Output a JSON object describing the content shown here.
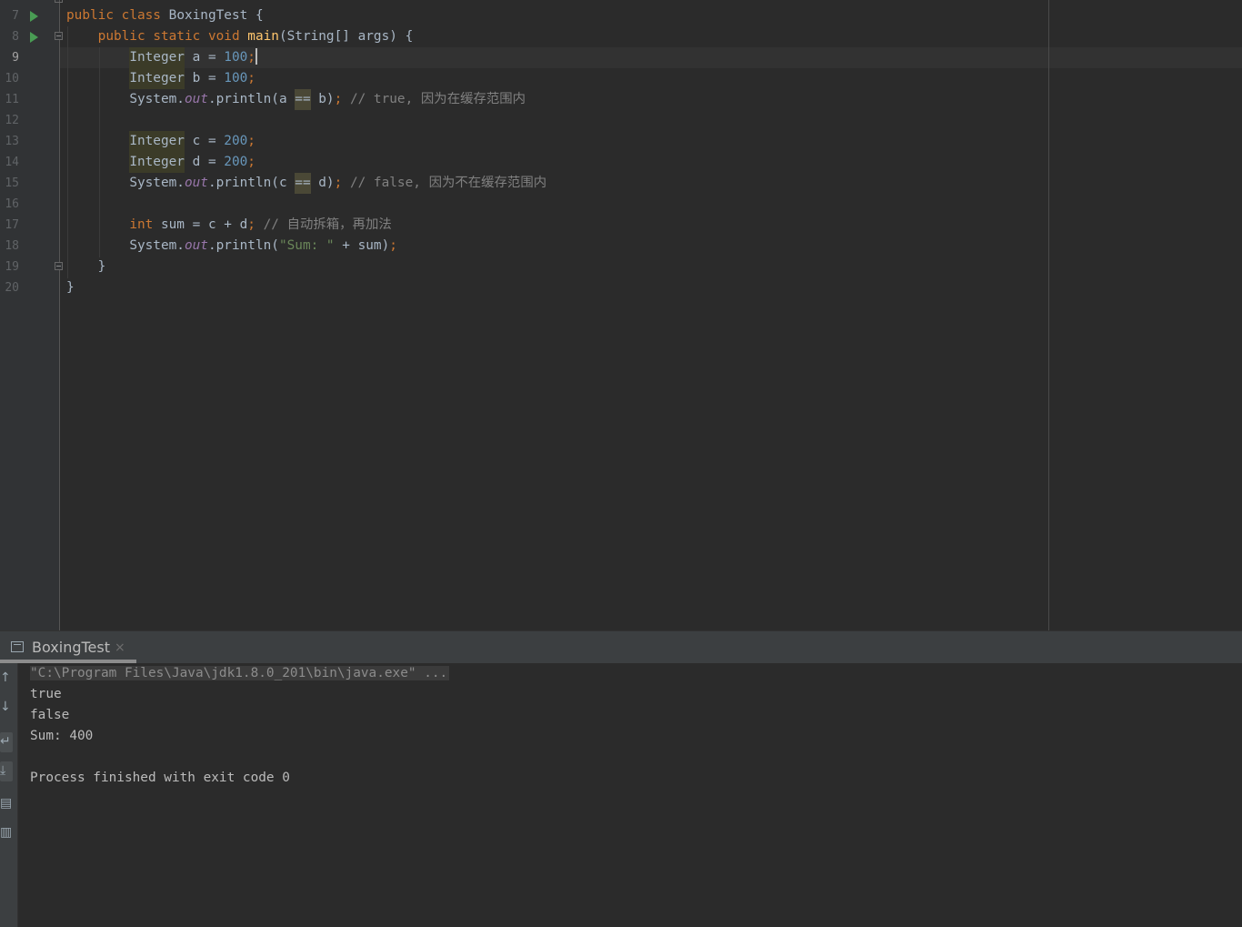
{
  "editor": {
    "line_numbers": [
      "7",
      "8",
      "9",
      "10",
      "11",
      "12",
      "13",
      "14",
      "15",
      "16",
      "17",
      "18",
      "19",
      "20"
    ],
    "current_line": "9",
    "lines": {
      "l7": {
        "kw1": "public",
        "kw2": "class",
        "name": "BoxingTest",
        "brace": "{"
      },
      "l8": {
        "kw1": "public",
        "kw2": "static",
        "kw3": "void",
        "fn": "main",
        "rest": "(String[] args) {"
      },
      "l9": {
        "type": "Integer",
        "decl": " a = ",
        "num": "100",
        "semi": ";"
      },
      "l10": {
        "type": "Integer",
        "decl": " b = ",
        "num": "100",
        "semi": ";"
      },
      "l11": {
        "sys": "System.",
        "out": "out",
        "call": ".println(a ",
        "op": "==",
        "rest": " b)",
        "semi": ";",
        "comment": " // true, 因为在缓存范围内"
      },
      "l13": {
        "type": "Integer",
        "decl": " c = ",
        "num": "200",
        "semi": ";"
      },
      "l14": {
        "type": "Integer",
        "decl": " d = ",
        "num": "200",
        "semi": ";"
      },
      "l15": {
        "sys": "System.",
        "out": "out",
        "call": ".println(c ",
        "op": "==",
        "rest": " d)",
        "semi": ";",
        "comment": " // false, 因为不在缓存范围内"
      },
      "l17": {
        "kw": "int",
        "rest": " sum = c + d",
        "semi": ";",
        "comment": " // 自动拆箱，再加法"
      },
      "l18": {
        "sys": "System.",
        "out": "out",
        "call": ".println(",
        "str": "\"Sum: \"",
        "rest": " + sum)",
        "semi": ";"
      },
      "l19": {
        "text": "}"
      },
      "l20": {
        "text": "}"
      }
    }
  },
  "run_panel": {
    "tab_label": "BoxingTest",
    "tab_close": "×",
    "toolbar_icons": [
      "up-arrow-icon",
      "down-arrow-icon",
      "soft-wrap-icon",
      "scroll-to-end-icon",
      "print-icon",
      "trash-icon"
    ],
    "console": {
      "command": "\"C:\\Program Files\\Java\\jdk1.8.0_201\\bin\\java.exe\" ...",
      "output": [
        "true",
        "false",
        "Sum: 400",
        "",
        "Process finished with exit code 0"
      ]
    }
  },
  "colors": {
    "keyword": "#cc7832",
    "number": "#6897bb",
    "method": "#ffc66d",
    "static_field": "#9876aa",
    "comment": "#808080",
    "string": "#6a8759",
    "run_icon": "#499c54"
  }
}
